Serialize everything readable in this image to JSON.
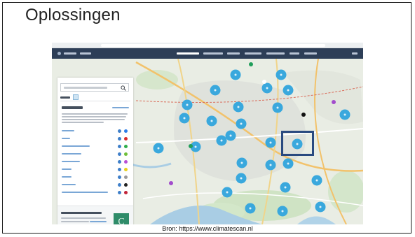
{
  "slide": {
    "title": "Oplossingen",
    "source": "Bron: https://www.climatescan.nl"
  },
  "colors": {
    "map_cluster": "#3aa8dd",
    "highlight": "#2a4a80",
    "navbar": "#2d3e57",
    "brand": "#2f8c69"
  },
  "screenshot": {
    "category_dot_colors": [
      "#2b7de9",
      "#d92b2b",
      "#2fae4a",
      "#6fbf3a",
      "#b84fd6",
      "#e8d11c",
      "#9a9a9a",
      "#222222",
      "#c2243a"
    ],
    "map_marker_colors": [
      "#3aa8dd",
      "#1f9e5a",
      "#a24ccc",
      "#111111",
      "#ffffff"
    ]
  }
}
